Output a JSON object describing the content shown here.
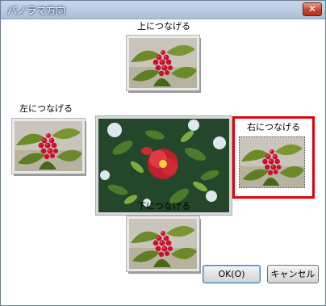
{
  "window": {
    "title": "パノラマ方向",
    "close_label": "✕"
  },
  "directions": {
    "top": "上につなげる",
    "left": "左につなげる",
    "right": "右につなげる",
    "bottom": "下につなげる"
  },
  "buttons": {
    "ok": "OK(O)",
    "cancel": "キャンセル"
  },
  "selected_direction": "right",
  "colors": {
    "selection": "#e3000b",
    "flower": "#d8202a",
    "leaf": "#4e7a23"
  }
}
